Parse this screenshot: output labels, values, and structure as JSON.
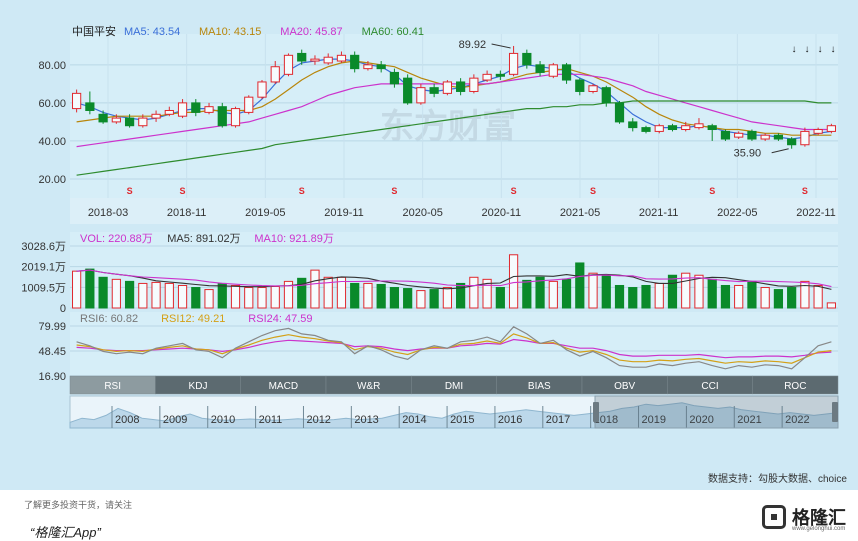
{
  "chart_data": {
    "type": "candlestick",
    "stock_name": "中国平安",
    "ma_legend": [
      {
        "label": "MA5: 43.54",
        "color": "#3a6fd8"
      },
      {
        "label": "MA10: 43.15",
        "color": "#b8860b"
      },
      {
        "label": "MA20: 45.87",
        "color": "#cc33cc"
      },
      {
        "label": "MA60: 60.41",
        "color": "#2e8b2e"
      }
    ],
    "price_axis": {
      "ticks": [
        "80.00",
        "60.00",
        "40.00",
        "20.00"
      ],
      "ylim": [
        10,
        92
      ]
    },
    "x_ticks": [
      "2018-03",
      "2018-11",
      "2019-05",
      "2019-11",
      "2020-05",
      "2020-11",
      "2021-05",
      "2021-11",
      "2022-05",
      "2022-11"
    ],
    "annotations": {
      "high": "89.92",
      "low": "35.90"
    },
    "candles": [
      {
        "o": 57,
        "c": 65,
        "h": 67,
        "l": 55
      },
      {
        "o": 60,
        "c": 56,
        "h": 66,
        "l": 54
      },
      {
        "o": 54,
        "c": 50,
        "h": 56,
        "l": 49
      },
      {
        "o": 50,
        "c": 52,
        "h": 54,
        "l": 49
      },
      {
        "o": 52,
        "c": 48,
        "h": 54,
        "l": 47
      },
      {
        "o": 48,
        "c": 52,
        "h": 54,
        "l": 47
      },
      {
        "o": 52,
        "c": 54,
        "h": 56,
        "l": 50
      },
      {
        "o": 54,
        "c": 56,
        "h": 58,
        "l": 53
      },
      {
        "o": 53,
        "c": 60,
        "h": 62,
        "l": 52
      },
      {
        "o": 60,
        "c": 55,
        "h": 62,
        "l": 53
      },
      {
        "o": 55,
        "c": 58,
        "h": 60,
        "l": 54
      },
      {
        "o": 58,
        "c": 48,
        "h": 60,
        "l": 47
      },
      {
        "o": 48,
        "c": 57,
        "h": 58,
        "l": 47
      },
      {
        "o": 55,
        "c": 63,
        "h": 64,
        "l": 54
      },
      {
        "o": 63,
        "c": 71,
        "h": 72,
        "l": 62
      },
      {
        "o": 71,
        "c": 79,
        "h": 82,
        "l": 70
      },
      {
        "o": 75,
        "c": 85,
        "h": 86,
        "l": 74
      },
      {
        "o": 86,
        "c": 82,
        "h": 88,
        "l": 80
      },
      {
        "o": 82,
        "c": 83,
        "h": 85,
        "l": 80
      },
      {
        "o": 81,
        "c": 84,
        "h": 86,
        "l": 80
      },
      {
        "o": 82,
        "c": 85,
        "h": 87,
        "l": 81
      },
      {
        "o": 85,
        "c": 78,
        "h": 87,
        "l": 76
      },
      {
        "o": 78,
        "c": 80,
        "h": 82,
        "l": 77
      },
      {
        "o": 80,
        "c": 78,
        "h": 82,
        "l": 76
      },
      {
        "o": 76,
        "c": 70,
        "h": 78,
        "l": 68
      },
      {
        "o": 73,
        "c": 60,
        "h": 75,
        "l": 59
      },
      {
        "o": 60,
        "c": 68,
        "h": 70,
        "l": 59
      },
      {
        "o": 68,
        "c": 65,
        "h": 70,
        "l": 63
      },
      {
        "o": 65,
        "c": 71,
        "h": 72,
        "l": 64
      },
      {
        "o": 71,
        "c": 66,
        "h": 73,
        "l": 64
      },
      {
        "o": 66,
        "c": 73,
        "h": 75,
        "l": 65
      },
      {
        "o": 72,
        "c": 75,
        "h": 77,
        "l": 71
      },
      {
        "o": 75,
        "c": 74,
        "h": 77,
        "l": 72
      },
      {
        "o": 75,
        "c": 86,
        "h": 89.92,
        "l": 74
      },
      {
        "o": 86,
        "c": 80,
        "h": 88,
        "l": 78
      },
      {
        "o": 80,
        "c": 76,
        "h": 82,
        "l": 74
      },
      {
        "o": 74,
        "c": 80,
        "h": 81,
        "l": 73
      },
      {
        "o": 80,
        "c": 72,
        "h": 81,
        "l": 70
      },
      {
        "o": 72,
        "c": 66,
        "h": 73,
        "l": 64
      },
      {
        "o": 66,
        "c": 69,
        "h": 70,
        "l": 65
      },
      {
        "o": 68,
        "c": 60,
        "h": 69,
        "l": 58
      },
      {
        "o": 60,
        "c": 50,
        "h": 61,
        "l": 49
      },
      {
        "o": 50,
        "c": 47,
        "h": 52,
        "l": 45
      },
      {
        "o": 47,
        "c": 45,
        "h": 48,
        "l": 44
      },
      {
        "o": 45,
        "c": 48,
        "h": 49,
        "l": 44
      },
      {
        "o": 48,
        "c": 46,
        "h": 49,
        "l": 45
      },
      {
        "o": 46,
        "c": 48,
        "h": 50,
        "l": 45
      },
      {
        "o": 47,
        "c": 49,
        "h": 52,
        "l": 46
      },
      {
        "o": 48,
        "c": 46,
        "h": 49,
        "l": 40
      },
      {
        "o": 45,
        "c": 41,
        "h": 46,
        "l": 40
      },
      {
        "o": 42,
        "c": 44,
        "h": 45,
        "l": 41
      },
      {
        "o": 45,
        "c": 41,
        "h": 46,
        "l": 40
      },
      {
        "o": 41,
        "c": 43,
        "h": 44,
        "l": 40
      },
      {
        "o": 43,
        "c": 41,
        "h": 44,
        "l": 40
      },
      {
        "o": 41,
        "c": 38,
        "h": 42,
        "l": 35.9
      },
      {
        "o": 38,
        "c": 45,
        "h": 47,
        "l": 37
      },
      {
        "o": 44,
        "c": 46,
        "h": 47,
        "l": 43
      },
      {
        "o": 45,
        "c": 48,
        "h": 49,
        "l": 44
      }
    ],
    "ma_series": {
      "ma5": [
        60,
        58,
        55,
        53,
        52,
        51,
        52,
        54,
        56,
        57,
        57,
        55,
        54,
        56,
        62,
        70,
        77,
        81,
        82,
        83,
        83,
        82,
        80,
        79,
        75,
        69,
        67,
        66,
        67,
        68,
        70,
        72,
        74,
        78,
        80,
        79,
        78,
        77,
        73,
        70,
        66,
        60,
        54,
        50,
        47,
        47,
        47,
        48,
        47,
        45,
        44,
        43,
        43,
        42,
        41,
        42,
        44,
        45
      ],
      "ma10": [
        50,
        51,
        52,
        53,
        53,
        53,
        53,
        54,
        55,
        55,
        56,
        56,
        56,
        56,
        58,
        62,
        67,
        72,
        76,
        79,
        81,
        82,
        81,
        80,
        79,
        76,
        73,
        71,
        69,
        68,
        69,
        70,
        71,
        73,
        75,
        76,
        77,
        78,
        76,
        74,
        71,
        67,
        63,
        58,
        54,
        51,
        49,
        48,
        47,
        46,
        46,
        45,
        44,
        44,
        43,
        43,
        43,
        43
      ],
      "ma20": [
        37,
        38,
        39,
        40,
        41,
        42,
        43,
        44,
        45,
        46,
        47,
        48,
        49,
        50,
        52,
        54,
        56,
        58,
        61,
        64,
        66,
        68,
        69,
        70,
        70,
        70,
        70,
        70,
        70,
        70,
        70,
        70,
        71,
        72,
        73,
        74,
        75,
        75,
        75,
        74,
        73,
        71,
        69,
        66,
        64,
        62,
        60,
        58,
        56,
        54,
        52,
        50,
        49,
        48,
        47,
        46,
        46,
        46
      ],
      "ma60": [
        22,
        23,
        24,
        25,
        26,
        27,
        28,
        29,
        30,
        31,
        32,
        33,
        34,
        35,
        36,
        38,
        39,
        40,
        41,
        42,
        43,
        44,
        45,
        46,
        47,
        48,
        49,
        50,
        51,
        52,
        53,
        54,
        55,
        56,
        57,
        57,
        58,
        58,
        59,
        59,
        60,
        60,
        61,
        61,
        61,
        61,
        61,
        61,
        61,
        61,
        61,
        61,
        61,
        61,
        61,
        61,
        60,
        60
      ]
    },
    "volume": {
      "legend": [
        {
          "label": "VOL: 220.88万",
          "color": "#cc33cc"
        },
        {
          "label": "MA5: 891.02万",
          "color": "#333333"
        },
        {
          "label": "MA10: 921.89万",
          "color": "#cc33cc"
        }
      ],
      "ticks": [
        "3028.6万",
        "2019.1万",
        "1009.5万",
        "0"
      ],
      "ymax": 3028.6,
      "values": [
        1800,
        1900,
        1500,
        1400,
        1300,
        1200,
        1250,
        1200,
        1100,
        1000,
        900,
        1200,
        1100,
        1000,
        1000,
        1050,
        1300,
        1450,
        1850,
        1500,
        1500,
        1200,
        1200,
        1150,
        1000,
        950,
        850,
        900,
        1000,
        1200,
        1500,
        1400,
        1000,
        2600,
        1350,
        1500,
        1300,
        1400,
        2200,
        1700,
        1600,
        1100,
        1000,
        1100,
        1200,
        1600,
        1700,
        1600,
        1400,
        1100,
        1100,
        1300,
        1000,
        900,
        1000,
        1300,
        1100,
        250
      ]
    },
    "rsi": {
      "legend": [
        {
          "label": "RSI6: 60.82",
          "color": "#777777"
        },
        {
          "label": "RSI12: 49.21",
          "color": "#d4a017"
        },
        {
          "label": "RSI24: 47.59",
          "color": "#cc33cc"
        }
      ],
      "ticks": [
        "79.99",
        "48.45",
        "16.90"
      ],
      "rsi6": [
        60,
        55,
        48,
        45,
        47,
        45,
        52,
        55,
        58,
        50,
        48,
        40,
        52,
        60,
        68,
        74,
        77,
        70,
        68,
        62,
        60,
        45,
        55,
        50,
        42,
        38,
        50,
        55,
        52,
        60,
        62,
        66,
        60,
        79,
        70,
        58,
        62,
        50,
        42,
        48,
        40,
        30,
        28,
        28,
        32,
        30,
        33,
        35,
        30,
        26,
        30,
        28,
        31,
        30,
        26,
        40,
        55,
        60
      ],
      "rsi12": [
        56,
        54,
        50,
        48,
        49,
        48,
        51,
        53,
        55,
        51,
        50,
        45,
        51,
        56,
        62,
        66,
        69,
        66,
        64,
        61,
        59,
        50,
        54,
        52,
        47,
        44,
        50,
        53,
        52,
        57,
        58,
        61,
        58,
        70,
        65,
        58,
        59,
        52,
        47,
        49,
        44,
        37,
        35,
        35,
        37,
        36,
        38,
        39,
        36,
        33,
        35,
        34,
        36,
        35,
        33,
        40,
        47,
        49
      ],
      "rsi24": [
        53,
        52,
        50,
        49,
        49,
        49,
        50,
        51,
        52,
        51,
        50,
        48,
        50,
        53,
        57,
        60,
        62,
        61,
        60,
        59,
        58,
        54,
        55,
        54,
        51,
        49,
        51,
        52,
        52,
        55,
        56,
        58,
        57,
        63,
        61,
        58,
        58,
        55,
        52,
        52,
        49,
        44,
        42,
        42,
        43,
        43,
        43,
        44,
        42,
        40,
        41,
        41,
        42,
        42,
        41,
        43,
        46,
        47
      ]
    },
    "indicator_tabs": [
      "RSI",
      "KDJ",
      "MACD",
      "W&R",
      "DMI",
      "BIAS",
      "OBV",
      "CCI",
      "ROC"
    ],
    "navigator_years": [
      "2008",
      "2009",
      "2010",
      "2011",
      "2012",
      "2013",
      "2014",
      "2015",
      "2016",
      "2017",
      "2018",
      "2019",
      "2020",
      "2021",
      "2022"
    ],
    "navigator_area": [
      0.2,
      0.35,
      0.3,
      0.45,
      0.7,
      0.55,
      0.35,
      0.3,
      0.25,
      0.4,
      0.5,
      0.35,
      0.3,
      0.28,
      0.3,
      0.32,
      0.3,
      0.28,
      0.3,
      0.33,
      0.3,
      0.28,
      0.3,
      0.35,
      0.3,
      0.32,
      0.35,
      0.45,
      0.55,
      0.5,
      0.4,
      0.35,
      0.5,
      0.6,
      0.55,
      0.5,
      0.55,
      0.6,
      0.65,
      0.6,
      0.55,
      0.5,
      0.45,
      0.5,
      0.55,
      0.6,
      0.7,
      0.75,
      0.85,
      0.8,
      0.85,
      0.9,
      0.8,
      0.75,
      0.7,
      0.75,
      0.65,
      0.6,
      0.55,
      0.5,
      0.55,
      0.5,
      0.45,
      0.5,
      0.55
    ]
  },
  "watermark": "东方财富",
  "footer": {
    "source": "数据支持：勾股大数据、choice",
    "left_note": "了解更多投资干货，请关注",
    "app": "“格隆汇App”",
    "brand_name": "格隆汇",
    "brand_url": "www.gelonghui.com"
  }
}
